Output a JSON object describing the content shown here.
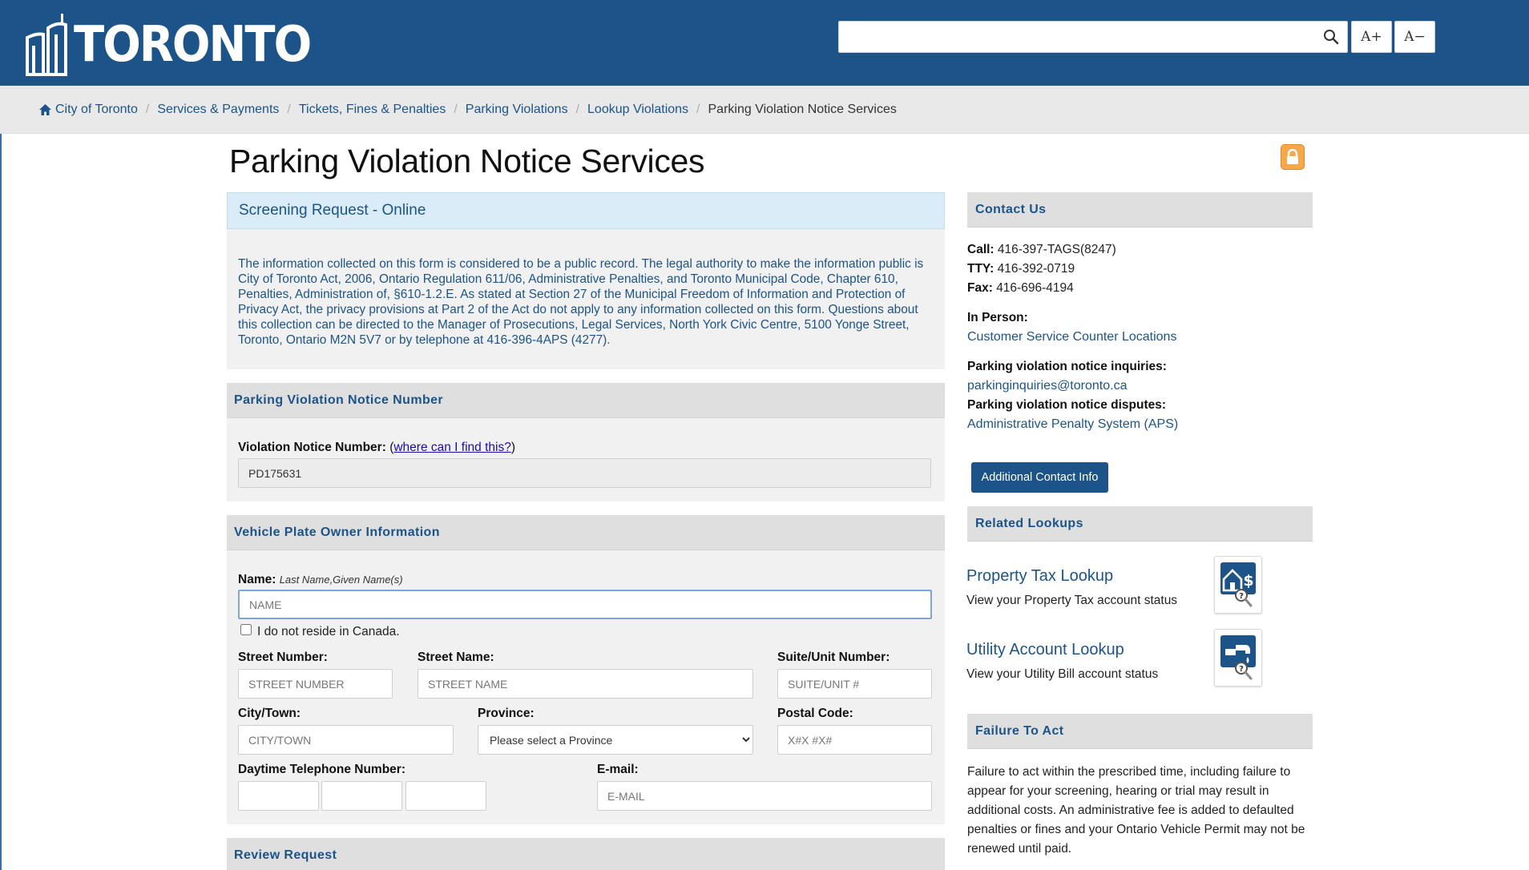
{
  "header": {
    "logo_text": "TORONTO",
    "search_placeholder": "",
    "font_increase": "A+",
    "font_decrease": "A−",
    "brand_color": "#1c5489"
  },
  "breadcrumb": {
    "items": [
      "City of Toronto",
      "Services & Payments",
      "Tickets, Fines & Penalties",
      "Parking Violations",
      "Lookup Violations"
    ],
    "current": "Parking Violation Notice Services"
  },
  "page_title": "Parking Violation Notice Services",
  "screening": {
    "heading": "Screening Request - Online",
    "notice": "The information collected on this form is considered to be a public record. The legal authority to make the information public is City of Toronto Act, 2006, Ontario Regulation 611/06, Administrative Penalties, and Toronto Municipal Code, Chapter 610, Penalties, Administration of, §610-1.2.E. As stated at Section 27 of the Municipal Freedom of Information and Protection of Privacy Act, the privacy provisions at Part 2 of the Act do not apply to any information collected on this form. Questions about this collection can be directed to the Manager of Prosecutions, Legal Services, North York Civic Centre, 5100 Yonge Street, Toronto, Ontario M2N 5V7 or by telephone at 416-396-4APS (4277)."
  },
  "violation_section": {
    "heading": "Parking Violation Notice Number",
    "label": "Violation Notice Number:",
    "help_open": "(",
    "help_link": "where can I find this?",
    "help_close": ")",
    "value": "PD175631"
  },
  "owner_section": {
    "heading": "Vehicle Plate Owner Information",
    "name_label": "Name:",
    "name_hint": "Last Name,Given Name(s)",
    "name_placeholder": "NAME",
    "non_resident": "I do not reside in Canada.",
    "street_number_label": "Street Number:",
    "street_number_placeholder": "STREET NUMBER",
    "street_name_label": "Street Name:",
    "street_name_placeholder": "STREET NAME",
    "suite_label": "Suite/Unit Number:",
    "suite_placeholder": "SUITE/UNIT #",
    "city_label": "City/Town:",
    "city_placeholder": "CITY/TOWN",
    "province_label": "Province:",
    "province_selected": "Please select a Province",
    "postal_label": "Postal Code:",
    "postal_placeholder": "X#X #X#",
    "phone_label": "Daytime Telephone Number:",
    "email_label": "E-mail:",
    "email_placeholder": "E-MAIL"
  },
  "review_section": {
    "heading": "Review Request"
  },
  "contact": {
    "heading": "Contact Us",
    "call_label": "Call:",
    "call_value": "416-397-TAGS(8247)",
    "tty_label": "TTY:",
    "tty_value": "416-392-0719",
    "fax_label": "Fax:",
    "fax_value": "416-696-4194",
    "in_person_label": "In Person:",
    "in_person_link": "Customer Service Counter Locations",
    "inquiries_label": "Parking violation notice inquiries:",
    "inquiries_email": "parkinginquiries@toronto.ca",
    "disputes_label": "Parking violation notice disputes:",
    "disputes_link": "Administrative Penalty System (APS)",
    "button": "Additional Contact Info"
  },
  "related": {
    "heading": "Related Lookups",
    "items": [
      {
        "title": "Property Tax Lookup",
        "desc": "View your Property Tax account status",
        "icon": "house-dollar-icon"
      },
      {
        "title": "Utility Account Lookup",
        "desc": "View your Utility Bill account status",
        "icon": "water-tap-icon"
      }
    ]
  },
  "failure": {
    "heading": "Failure To Act",
    "text": "Failure to act within the prescribed time, including failure to appear for your screening, hearing or trial may result in additional costs. An administrative fee is added to defaulted penalties or fines and your Ontario Vehicle Permit may not be renewed until paid."
  }
}
